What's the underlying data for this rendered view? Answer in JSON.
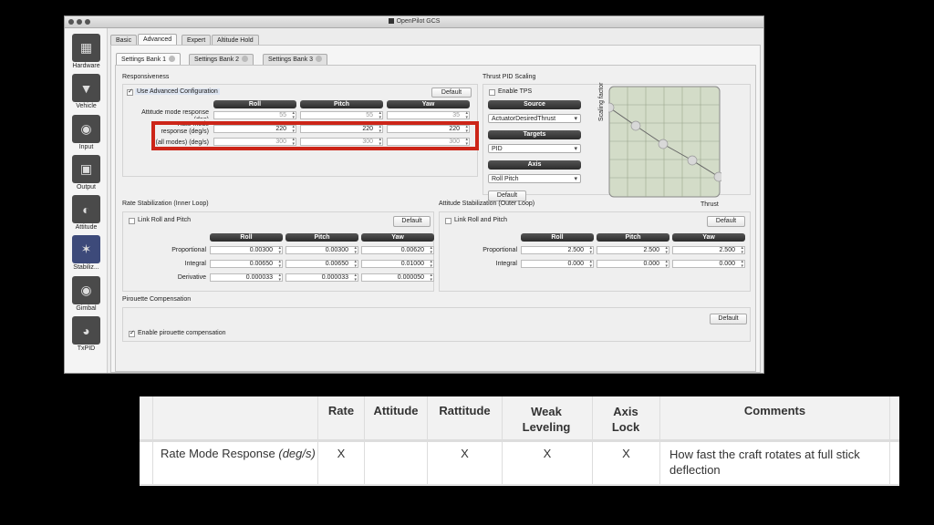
{
  "window": {
    "title": "OpenPilot GCS"
  },
  "sidebar": {
    "items": [
      {
        "label": "Hardware",
        "icon": "chip-icon"
      },
      {
        "label": "Vehicle",
        "icon": "vehicle-icon"
      },
      {
        "label": "Input",
        "icon": "transmitter-icon"
      },
      {
        "label": "Output",
        "icon": "motor-icon"
      },
      {
        "label": "Attitude",
        "icon": "attitude-icon"
      },
      {
        "label": "Stabiliz...",
        "icon": "stabilization-icon"
      },
      {
        "label": "Gimbal",
        "icon": "camera-icon"
      },
      {
        "label": "TxPID",
        "icon": "gauge-icon"
      }
    ]
  },
  "top_tabs": [
    "Basic",
    "Advanced",
    "Expert",
    "Altitude Hold"
  ],
  "bank_tabs": [
    "Settings Bank 1",
    "Settings Bank 2",
    "Settings Bank 3"
  ],
  "responsiveness": {
    "title": "Responsiveness",
    "use_advanced": "Use Advanced Configuration",
    "default": "Default",
    "headers": [
      "Roll",
      "Pitch",
      "Yaw"
    ],
    "row1_label": "Attitude mode response (deg)",
    "row1_values": [
      "55",
      "55",
      "35"
    ],
    "row2_label_a": "Rate mode",
    "row2_label_b": "response (deg/s)",
    "row2_values": [
      "220",
      "220",
      "220"
    ],
    "row3_label": "(all modes) (deg/s)",
    "row3_values": [
      "300",
      "300",
      "300"
    ]
  },
  "thrust": {
    "title": "Thrust PID Scaling",
    "enable_tps": "Enable TPS",
    "source_label": "Source",
    "source_value": "ActuatorDesiredThrust",
    "targets_label": "Targets",
    "targets_value": "PID",
    "axis_label": "Axis",
    "axis_value": "Roll Pitch",
    "default": "Default",
    "y_axis": "Scaling factor",
    "x_axis": "Thrust"
  },
  "rate_stab": {
    "title": "Rate Stabilization (Inner Loop)",
    "link": "Link Roll and Pitch",
    "default": "Default",
    "headers": [
      "Roll",
      "Pitch",
      "Yaw"
    ],
    "rows": [
      {
        "label": "Proportional",
        "values": [
          "0.00300",
          "0.00300",
          "0.00620"
        ]
      },
      {
        "label": "Integral",
        "values": [
          "0.00650",
          "0.00650",
          "0.01000"
        ]
      },
      {
        "label": "Derivative",
        "values": [
          "0.000033",
          "0.000033",
          "0.000050"
        ]
      }
    ]
  },
  "att_stab": {
    "title": "Attitude Stabilization (Outer Loop)",
    "link": "Link Roll and Pitch",
    "default": "Default",
    "headers": [
      "Roll",
      "Pitch",
      "Yaw"
    ],
    "rows": [
      {
        "label": "Proportional",
        "values": [
          "2.500",
          "2.500",
          "2.500"
        ]
      },
      {
        "label": "Integral",
        "values": [
          "0.000",
          "0.000",
          "0.000"
        ]
      }
    ]
  },
  "pirouette": {
    "title": "Pirouette Compensation",
    "default": "Default",
    "enable": "Enable pirouette compensation"
  },
  "table": {
    "headers": [
      "Rate",
      "Attitude",
      "Rattitude",
      "Weak Leveling",
      "Axis Lock",
      "Comments"
    ],
    "row_label": "Rate Mode Response ",
    "row_label_unit": "(deg/s)",
    "cells": [
      "X",
      "",
      "X",
      "X",
      "X"
    ],
    "comment": "How fast the craft rotates at full stick deflection"
  }
}
